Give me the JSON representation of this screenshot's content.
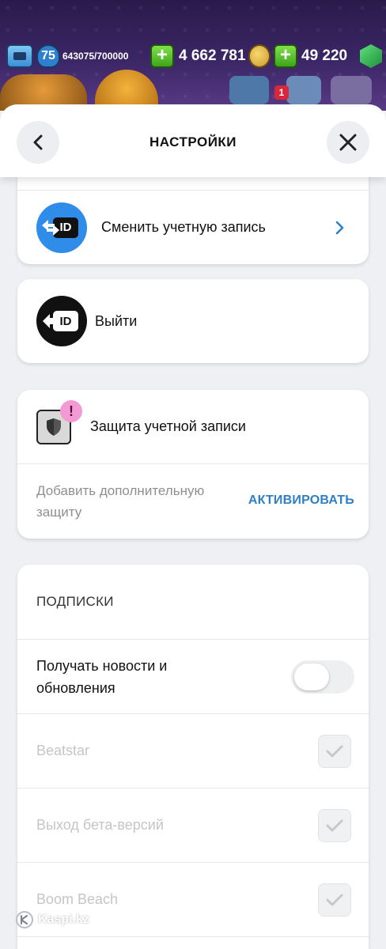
{
  "game_header": {
    "level": "75",
    "xp": "643075/700000",
    "coins": "4 662 781",
    "gems": "49 220",
    "notification_count": "1"
  },
  "settings": {
    "title": "НАСТРОЙКИ",
    "back_icon": "chevron-left-icon",
    "close_icon": "close-icon"
  },
  "account": {
    "switch_label": "Сменить учетную запись",
    "logout_label": "Выйти"
  },
  "protection": {
    "title": "Защита учетной записи",
    "alert_mark": "!",
    "description": "Добавить дополнительную защиту",
    "action": "АКТИВИРОВАТЬ"
  },
  "subscriptions": {
    "header": "ПОДПИСКИ",
    "news_label": "Получать новости и обновления",
    "news_enabled": false,
    "items": [
      {
        "label": "Beatstar",
        "checked": true
      },
      {
        "label": "Выход бета-версий",
        "checked": true
      },
      {
        "label": "Boom Beach",
        "checked": true
      }
    ]
  },
  "watermark": {
    "text": "Kaspi.kz"
  },
  "colors": {
    "accent": "#2f7fc4",
    "id_blue": "#2f8ce8",
    "panel_bg": "#eef0f3"
  }
}
